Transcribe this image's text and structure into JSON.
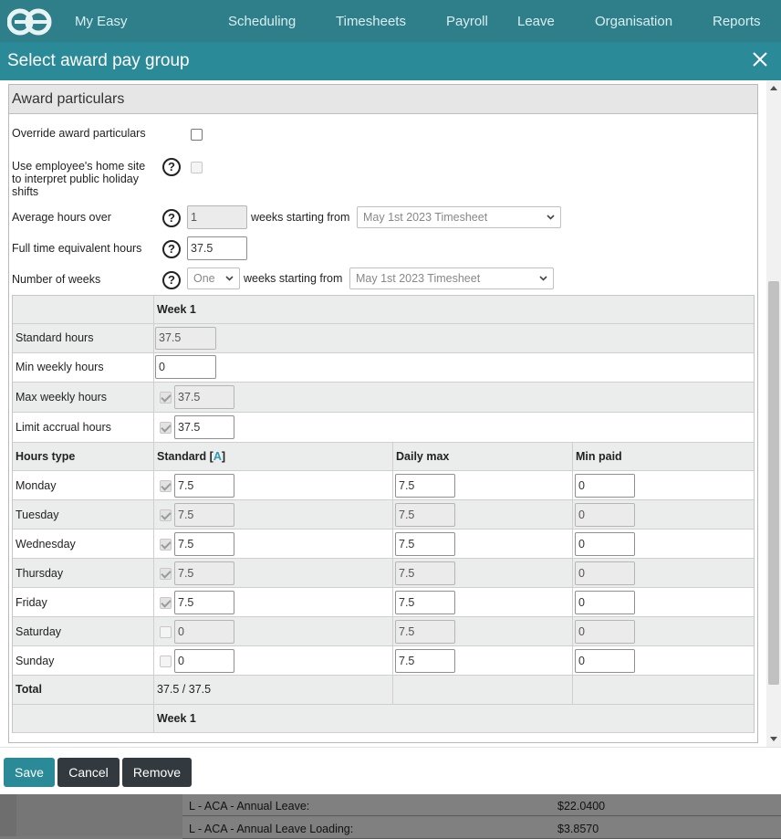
{
  "nav": {
    "items": [
      "My Easy",
      "Scheduling",
      "Timesheets",
      "Payroll",
      "Leave",
      "Organisation",
      "Reports"
    ]
  },
  "modal": {
    "title": "Select award pay group"
  },
  "section": {
    "title": "Award particulars"
  },
  "form": {
    "override_label": "Override award particulars",
    "home_site_label": "Use employee's home site to interpret public holiday shifts",
    "average_label": "Average hours over",
    "average_value": "1",
    "weeks_starting_label": "weeks starting from",
    "timesheet_value": "May 1st 2023 Timesheet",
    "fte_label": "Full time equivalent hours",
    "fte_value": "37.5",
    "num_weeks_label": "Number of weeks",
    "num_weeks_value": "One",
    "weeks_starting_label2": "weeks starting from",
    "timesheet_value2": "May 1st 2023 Timesheet"
  },
  "weekly": {
    "week_header": "Week 1",
    "rows": [
      {
        "label": "Standard hours",
        "value": "37.5"
      },
      {
        "label": "Min weekly hours",
        "value": "0"
      },
      {
        "label": "Max weekly hours",
        "value": "37.5"
      },
      {
        "label": "Limit accrual hours",
        "value": "37.5"
      }
    ]
  },
  "hours": {
    "headers": {
      "type": "Hours type",
      "standard": "Standard [",
      "standard_accent": "A",
      "standard_close": "]",
      "daily_max": "Daily max",
      "min_paid": "Min paid"
    },
    "days": [
      {
        "name": "Monday",
        "standard": "7.5",
        "daily_max": "7.5",
        "min_paid": "0"
      },
      {
        "name": "Tuesday",
        "standard": "7.5",
        "daily_max": "7.5",
        "min_paid": "0"
      },
      {
        "name": "Wednesday",
        "standard": "7.5",
        "daily_max": "7.5",
        "min_paid": "0"
      },
      {
        "name": "Thursday",
        "standard": "7.5",
        "daily_max": "7.5",
        "min_paid": "0"
      },
      {
        "name": "Friday",
        "standard": "7.5",
        "daily_max": "7.5",
        "min_paid": "0"
      },
      {
        "name": "Saturday",
        "standard": "0",
        "daily_max": "7.5",
        "min_paid": "0"
      },
      {
        "name": "Sunday",
        "standard": "0",
        "daily_max": "7.5",
        "min_paid": "0"
      }
    ],
    "total_label": "Total",
    "total_value": "37.5 / 37.5",
    "footer_week": "Week 1"
  },
  "buttons": {
    "save": "Save",
    "cancel": "Cancel",
    "remove": "Remove"
  },
  "background": {
    "rows": [
      {
        "label": "L - ACA - Annual Leave:",
        "value": "$22.0400"
      },
      {
        "label": "L - ACA - Annual Leave Loading:",
        "value": "$3.8570"
      }
    ]
  }
}
